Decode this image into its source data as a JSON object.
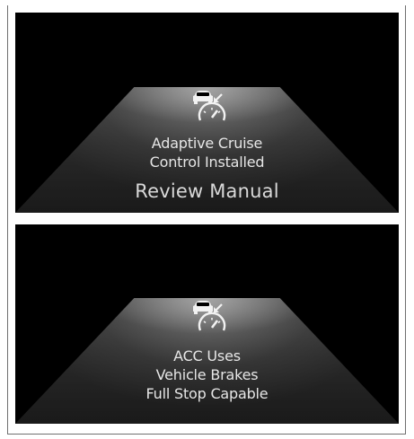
{
  "panels": [
    {
      "icon": "adaptive-cruise-control-icon",
      "lines": [
        "Adaptive Cruise",
        "Control Installed"
      ],
      "emphasis": "Review Manual"
    },
    {
      "icon": "adaptive-cruise-control-icon",
      "lines": [
        "ACC Uses",
        "Vehicle Brakes",
        "Full Stop Capable"
      ]
    }
  ],
  "colors": {
    "background": "#000000",
    "text": "#e6e6e6",
    "road": "#2a2a2a",
    "frame": "#6f6f6f"
  }
}
